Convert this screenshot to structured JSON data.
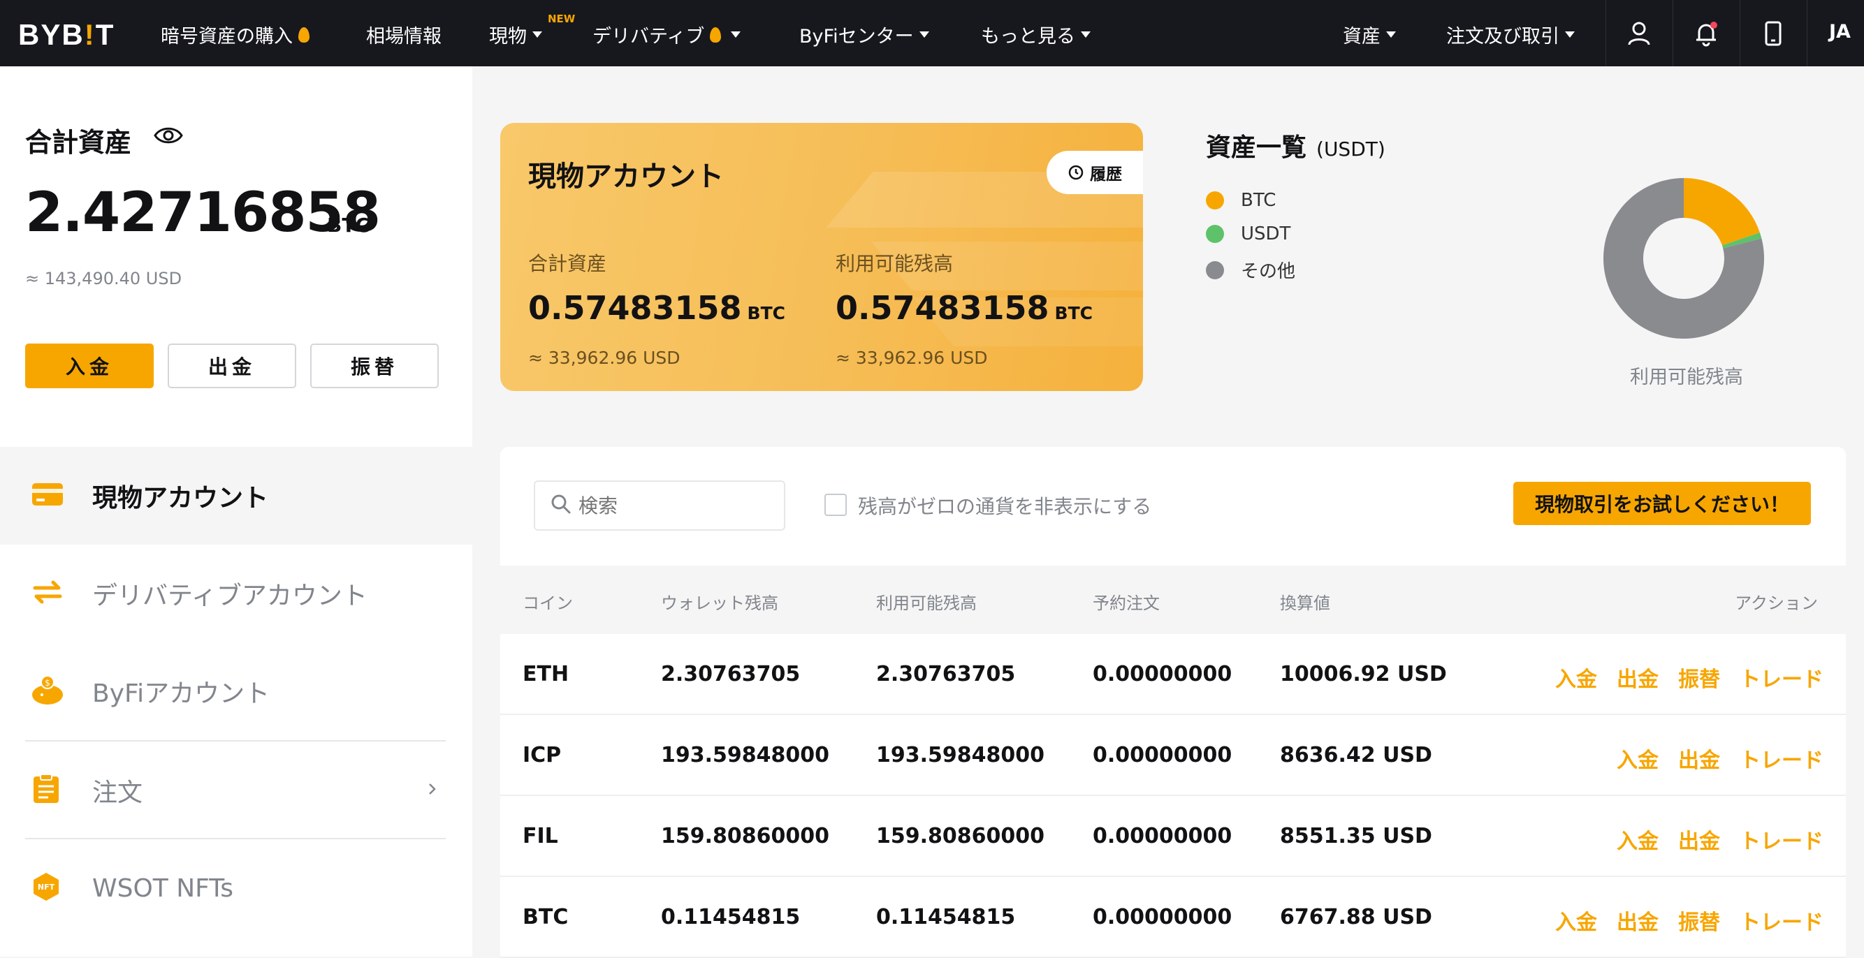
{
  "brand": {
    "logo_main": "BYB",
    "logo_bang": "!",
    "logo_end": "T"
  },
  "nav": {
    "buy_crypto": "暗号資産の購入",
    "markets": "相場情報",
    "spot": "現物",
    "new_badge": "NEW",
    "derivatives": "デリバティブ",
    "byfi_center": "ByFiセンター",
    "more": "もっと見る",
    "assets": "資産",
    "orders": "注文及び取引",
    "language": "JA"
  },
  "summary": {
    "title": "合計資産",
    "total_btc": "2.42716858",
    "unit": "BTC",
    "total_usd": "≈ 143,490.40 USD",
    "deposit": "入金",
    "withdraw": "出金",
    "transfer": "振替"
  },
  "sidebar": {
    "items": [
      {
        "label": "現物アカウント"
      },
      {
        "label": "デリバティブアカウント"
      },
      {
        "label": "ByFiアカウント"
      },
      {
        "label": "注文"
      },
      {
        "label": "WSOT NFTs"
      }
    ],
    "nft_badge": "NFT"
  },
  "spot_card": {
    "title": "現物アカウント",
    "history": "履歴",
    "total_label": "合計資産",
    "total_value": "0.57483158",
    "available_label": "利用可能残高",
    "available_value": "0.57483158",
    "unit": "BTC",
    "total_usd": "≈ 33,962.96 USD",
    "available_usd": "≈ 33,962.96 USD"
  },
  "asset_overview": {
    "title": "資産一覧",
    "unit": "(USDT)",
    "legend": [
      {
        "name": "BTC",
        "color": "#f7a600"
      },
      {
        "name": "USDT",
        "color": "#5ec26a"
      },
      {
        "name": "その他",
        "color": "#8a8b8f"
      }
    ],
    "caption": "利用可能残高",
    "chart_data": {
      "type": "pie",
      "categories": [
        "BTC",
        "USDT",
        "その他"
      ],
      "values": [
        19.8,
        1.2,
        79.0
      ],
      "colors": [
        "#f7a600",
        "#5ec26a",
        "#8a8b8f"
      ]
    }
  },
  "table": {
    "search_placeholder": "検索",
    "hide_zero_label": "残高がゼロの通貨を非表示にする",
    "trial_button": "現物取引をお試しください！",
    "headers": {
      "coin": "コイン",
      "wallet": "ウォレット残高",
      "available": "利用可能残高",
      "reserved": "予約注文",
      "converted": "換算値",
      "actions": "アクション"
    },
    "action_labels": {
      "deposit": "入金",
      "withdraw": "出金",
      "transfer": "振替",
      "trade": "トレード"
    },
    "rows": [
      {
        "coin": "ETH",
        "wallet": "2.30763705",
        "available": "2.30763705",
        "reserved": "0.00000000",
        "converted": "10006.92 USD"
      },
      {
        "coin": "ICP",
        "wallet": "193.59848000",
        "available": "193.59848000",
        "reserved": "0.00000000",
        "converted": "8636.42 USD"
      },
      {
        "coin": "FIL",
        "wallet": "159.80860000",
        "available": "159.80860000",
        "reserved": "0.00000000",
        "converted": "8551.35 USD"
      },
      {
        "coin": "BTC",
        "wallet": "0.11454815",
        "available": "0.11454815",
        "reserved": "0.00000000",
        "converted": "6767.88 USD"
      }
    ]
  }
}
